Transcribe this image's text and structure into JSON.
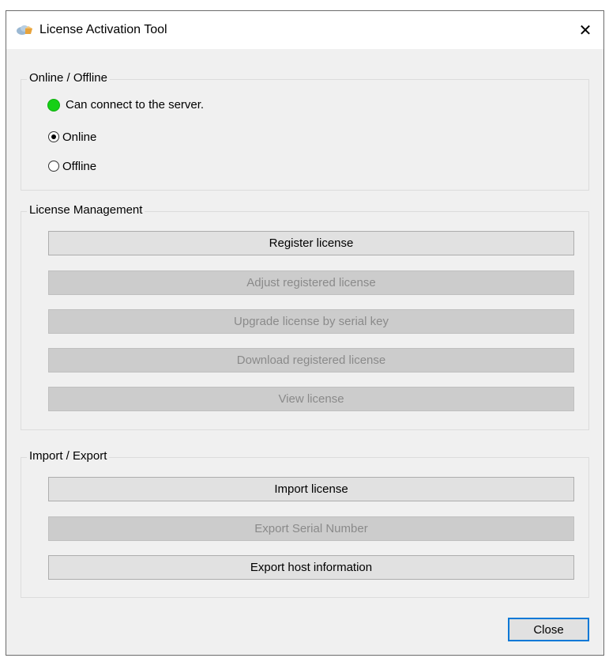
{
  "window": {
    "title": "License Activation Tool",
    "close_glyph": "✕"
  },
  "online_offline": {
    "legend": "Online / Offline",
    "status_text": "Can connect to the server.",
    "status_color": "#16d016",
    "online_label": "Online",
    "offline_label": "Offline",
    "selected": "Online"
  },
  "license_management": {
    "legend": "License Management",
    "register": "Register license",
    "adjust": "Adjust registered license",
    "upgrade": "Upgrade license by serial key",
    "download": "Download registered license",
    "view": "View license"
  },
  "import_export": {
    "legend": "Import / Export",
    "import": "Import license",
    "export_serial": "Export Serial Number",
    "export_host": "Export host information"
  },
  "footer": {
    "close_label": "Close"
  },
  "colors": {
    "window_bg": "#f0f0f0",
    "button_enabled": "#e1e1e1",
    "button_disabled": "#cccccc",
    "focus_border": "#0078d7"
  }
}
